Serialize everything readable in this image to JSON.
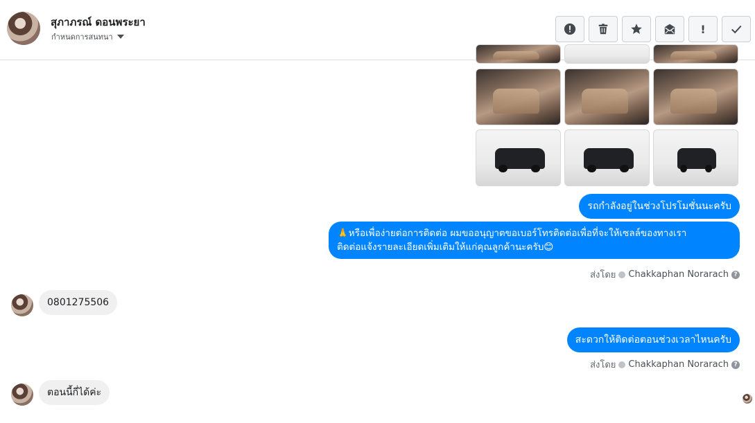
{
  "header": {
    "contact_name": "สุภาภรณ์ ดอนพระยา",
    "assign_label": "กำหนดการสนทนา",
    "toolbar": [
      {
        "name": "report-spam-button",
        "icon": "alert-circle-icon",
        "glyph": "!"
      },
      {
        "name": "delete-button",
        "icon": "trash-icon",
        "glyph": ""
      },
      {
        "name": "star-button",
        "icon": "star-icon",
        "glyph": "★"
      },
      {
        "name": "mark-unread-button",
        "icon": "envelope-icon",
        "glyph": ""
      },
      {
        "name": "follow-up-button",
        "icon": "exclamation-icon",
        "glyph": "!"
      },
      {
        "name": "mark-done-button",
        "icon": "checkmark-icon",
        "glyph": "✓"
      }
    ]
  },
  "messages": {
    "out_1": "รถกำลังอยู่ในช่วงโปรโมชั่นนะครับ",
    "out_2_line1": "🙏หรือเพื่อง่ายต่อการติดต่อ ผมขออนุญาตขอเบอร์โทรติดต่อเพื่อที่จะให้เซลล์ของทางเรา",
    "out_2_line2": "ติดต่อแจ้งรายละเอียดเพิ่มเติมให้แก่คุณลูกค้านะครับ😊",
    "sent_by_prefix": "ส่งโดย",
    "agent_name": "Chakkaphan Norarach",
    "in_1": "0801275506",
    "out_3": "สะดวกให้ติดต่อตอนช่วงเวลาไหนครับ",
    "in_2": "ตอนนี้กี่ได้ค่ะ"
  },
  "colors": {
    "outgoing_bubble": "#0084ff",
    "incoming_bubble": "#f1f0f0"
  }
}
